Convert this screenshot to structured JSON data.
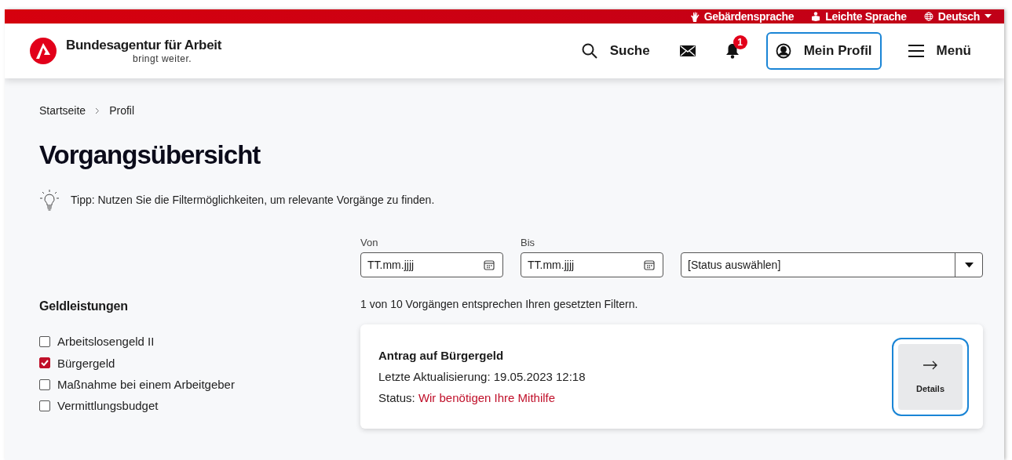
{
  "top_bar": {
    "links": [
      {
        "kind": "sign-language",
        "label": "Gebärdensprache"
      },
      {
        "kind": "easy-language",
        "label": "Leichte Sprache"
      },
      {
        "kind": "language",
        "label": "Deutsch"
      }
    ]
  },
  "header": {
    "logo": {
      "name": "Bundesagentur für Arbeit",
      "tagline": "bringt weiter."
    },
    "nav": [
      {
        "kind": "search",
        "label": "Suche"
      },
      {
        "kind": "mail"
      },
      {
        "kind": "notifications",
        "badge": "1"
      },
      {
        "kind": "profile",
        "label": "Mein Profil",
        "selected": true
      },
      {
        "kind": "menu",
        "label": "Menü"
      }
    ]
  },
  "breadcrumb": [
    "Startseite",
    "Profil"
  ],
  "title": "Vorgangsübersicht",
  "tip": "Tipp: Nutzen Sie die Filtermöglichkeiten, um relevante Vorgänge zu finden.",
  "filters": [
    {
      "kind": "date",
      "label": "Von",
      "placeholder": "TT.mm.jjjj"
    },
    {
      "kind": "date",
      "label": "Bis",
      "placeholder": "TT.mm.jjjj"
    },
    {
      "kind": "select",
      "value": "[Status auswählen]"
    }
  ],
  "category": {
    "heading": "Geldleistungen",
    "items": [
      {
        "label": "Arbeitslosengeld II",
        "checked": false
      },
      {
        "label": "Bürgergeld",
        "checked": true
      },
      {
        "label": "Maßnahme bei einem Arbeitgeber",
        "checked": false
      },
      {
        "label": "Vermittlungsbudget",
        "checked": false
      }
    ]
  },
  "result_count": "1 von 10 Vorgängen entsprechen Ihren gesetzten Filtern.",
  "cases": [
    {
      "title": "Antrag auf Bürgergeld",
      "updated": "Letzte Aktualisierung: 19.05.2023 12:18",
      "status_label": "Status:",
      "status": "Wir benötigen Ihre Mithilfe",
      "button": "Details"
    }
  ]
}
